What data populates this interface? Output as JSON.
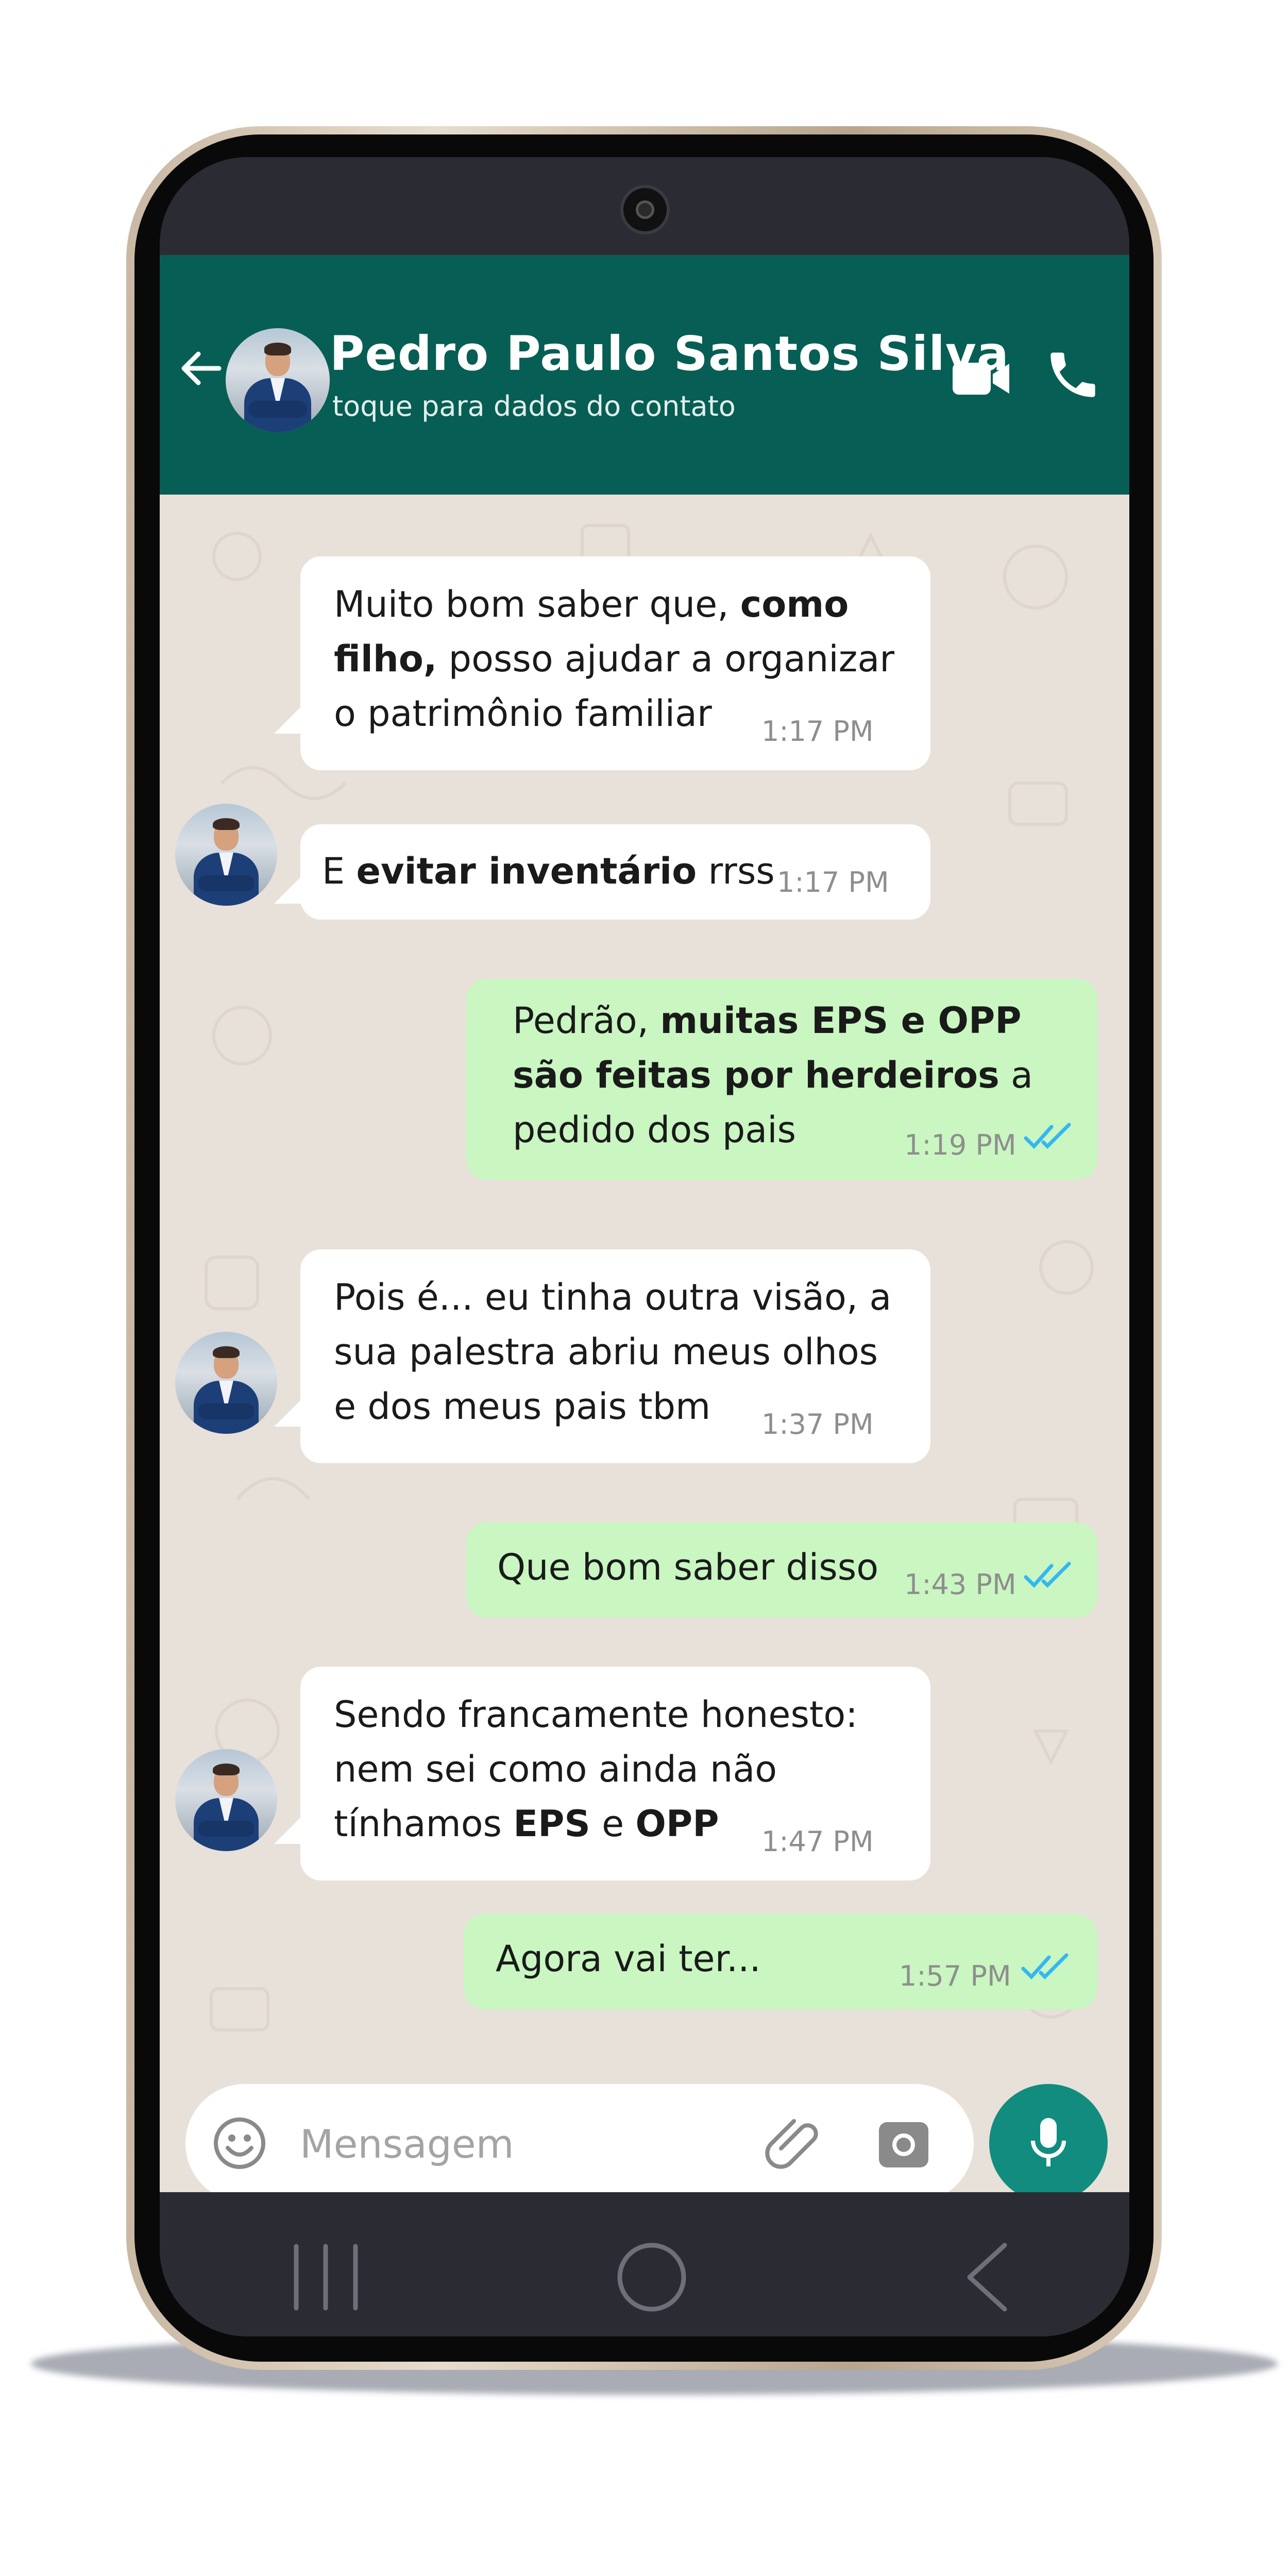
{
  "header": {
    "contact_name": "Pedro Paulo Santos Silva",
    "subtitle": "toque para dados do contato",
    "icons": [
      "back-arrow-icon",
      "video-call-icon",
      "phone-icon"
    ]
  },
  "messages": [
    {
      "direction": "in",
      "time": "1:17 PM"
    },
    {
      "direction": "in",
      "text": "E evitar inventário rrss",
      "time": "1:17 PM"
    },
    {
      "direction": "out",
      "time": "1:19 PM",
      "status": "read"
    },
    {
      "direction": "in",
      "time": "1:37 PM"
    },
    {
      "direction": "out",
      "text": "Que bom saber disso",
      "time": "1:43 PM",
      "status": "read"
    },
    {
      "direction": "in",
      "time": "1:47 PM"
    },
    {
      "direction": "out",
      "text": "Agora vai ter...",
      "time": "1:57 PM",
      "status": "read"
    }
  ],
  "msg1": {
    "l1a": "Muito bom saber que, ",
    "l1b": "como",
    "l2a": "filho,",
    "l2b": " posso ajudar a organizar",
    "l3": "o patrimônio familiar"
  },
  "msg2": {
    "a": "E ",
    "b": "evitar inventário",
    "c": " rrss"
  },
  "msg3": {
    "l1a": "Pedrão, ",
    "l1b": "muitas EPS e OPP",
    "l2a": "são feitas por herdeiros",
    "l2b": " a",
    "l3": "pedido dos pais"
  },
  "msg4": {
    "l1": "Pois é... eu tinha outra visão, a",
    "l2": "sua palestra abriu meus olhos",
    "l3": "e dos meus pais tbm"
  },
  "msg6": {
    "l1": "Sendo francamente honesto:",
    "l2": "nem sei como ainda não",
    "l3a": "tínhamos ",
    "l3b": "EPS",
    "l3c": " e ",
    "l3d": "OPP"
  },
  "composer": {
    "placeholder": "Mensagem",
    "icons": [
      "emoji-icon",
      "attach-icon",
      "camera-icon",
      "mic-icon"
    ]
  },
  "colors": {
    "header": "#075e54",
    "outgoing_bubble": "#c9f6c1",
    "incoming_bubble": "#ffffff",
    "chat_background": "#e8e1d9",
    "read_ticks": "#34b7f1",
    "mic_button": "#128c7e"
  },
  "navbar": {
    "icons": [
      "recent-apps-icon",
      "home-icon",
      "nav-back-icon"
    ]
  }
}
